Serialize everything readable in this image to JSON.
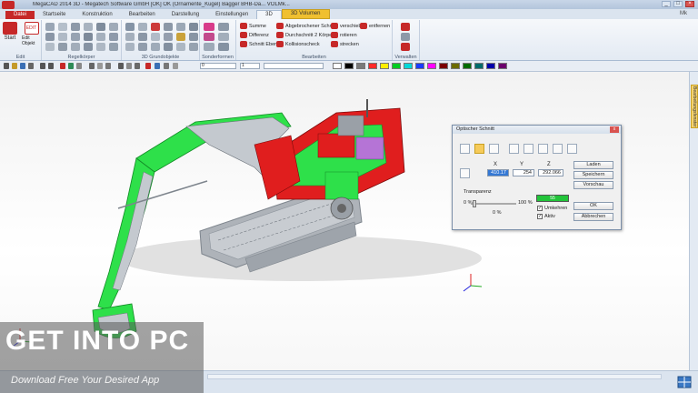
{
  "window": {
    "title": "MegaCAD 2014 3D - Megatech Software GmbH [OK] OK (Ornamente_Kugel) Bagger BHB-Da... VOLMk...",
    "controls": [
      "_",
      "□",
      "×"
    ]
  },
  "tabs": [
    {
      "label": "Datei"
    },
    {
      "label": "Startseite"
    },
    {
      "label": "Konstruktion"
    },
    {
      "label": "Bearbeiten"
    },
    {
      "label": "Darstellung"
    },
    {
      "label": "Einstellungen"
    },
    {
      "label": "3D"
    },
    {
      "label": "3D Volumen"
    }
  ],
  "help": "Mk",
  "ribbon": {
    "edit_group": {
      "label": "Edit",
      "start": "Start",
      "edit_object": "Edit Objekt",
      "edit_badge": "EDIT"
    },
    "groups": [
      {
        "label": "Regelkörper"
      },
      {
        "label": "3D Grundobjekte"
      },
      {
        "label": "Sonderformen"
      },
      {
        "label": "Bearbeiten"
      },
      {
        "label": "Verwalten"
      }
    ],
    "bearbeiten_cmds": [
      [
        "Summe",
        "Differenz",
        "Schnitt Ebene"
      ],
      [
        "Abgebrochener Schnitt",
        "Durchschnitt 2 Körper",
        "Kollisionscheck"
      ],
      [
        "verschieben",
        "rotieren",
        "strecken"
      ],
      [
        "entfernen"
      ]
    ]
  },
  "toolbar": {
    "palette": [
      "#ffffff",
      "#000000",
      "#7a7a7a",
      "#ff2a2a",
      "#ffee00",
      "#00cc22",
      "#00d8d8",
      "#1a3cff",
      "#ff00ff",
      "#7a0000",
      "#6b6b00",
      "#006b00",
      "#006b6b",
      "#0000aa",
      "#6b006b"
    ],
    "field_a": "0",
    "field_b": "1"
  },
  "side_panel": {
    "tab": "Bearbeitungsfenster"
  },
  "dialog": {
    "title": "Optischer Schnitt",
    "close": "x",
    "axes": {
      "x_label": "X",
      "y_label": "Y",
      "z_label": "Z"
    },
    "values": {
      "x": "410.17",
      "y": "254",
      "z": "292.066"
    },
    "buttons": {
      "laden": "Laden",
      "speichern": "Speichern",
      "vorschau": "Vorschau",
      "ok": "OK",
      "abbrechen": "Abbrechen"
    },
    "transparency": {
      "label": "Transparenz",
      "min": "0 %",
      "max": "100 %",
      "value": "0 %"
    },
    "color_value": "55",
    "checkboxes": [
      {
        "label": "Umkehren",
        "checked": true
      },
      {
        "label": "Aktiv",
        "checked": true
      }
    ]
  },
  "watermark": {
    "logo": "GET INTO PC",
    "tagline": "Download Free Your Desired App"
  },
  "colors": {
    "model_green": "#2ee04a",
    "model_red": "#e01e1e",
    "model_grey": "#b9bec4",
    "accent": "#f0c030"
  }
}
